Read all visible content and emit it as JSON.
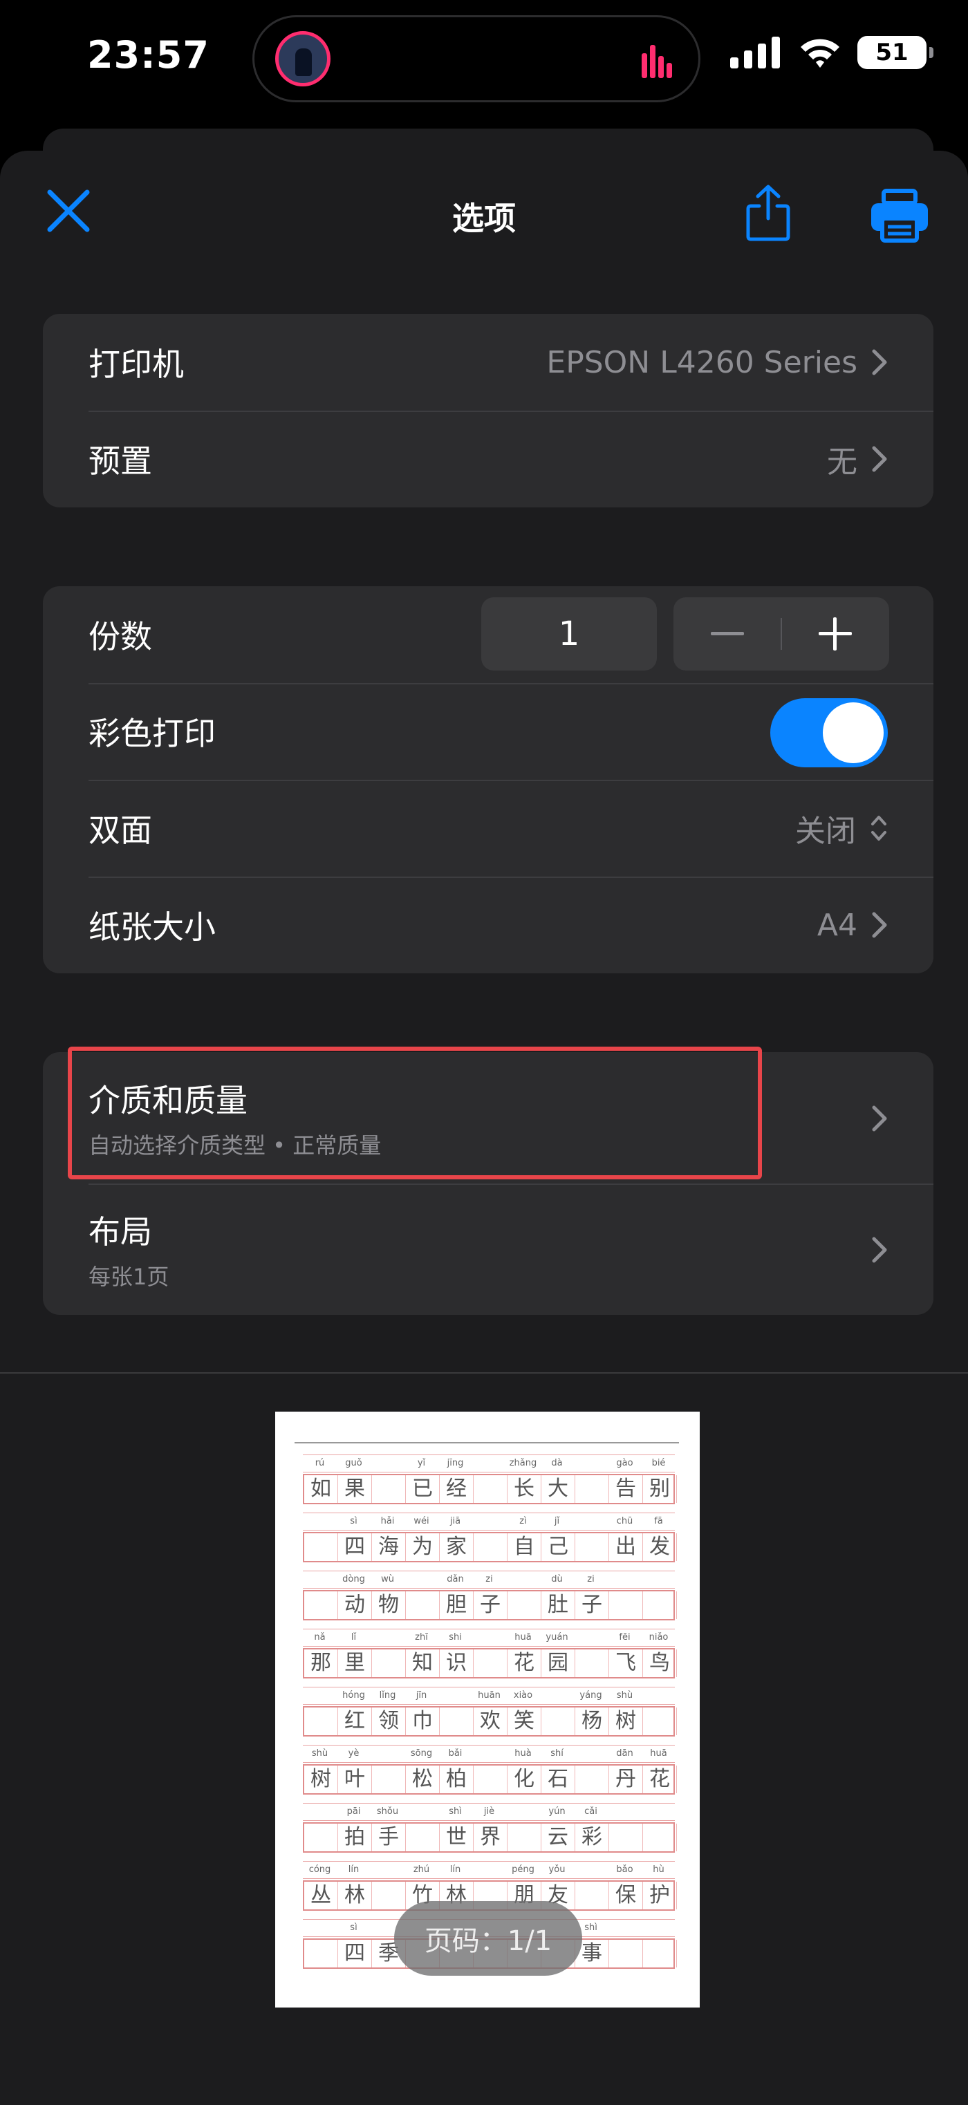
{
  "status_bar": {
    "time": "23:57",
    "battery": "51"
  },
  "nav": {
    "title": "选项"
  },
  "printer_group": {
    "rows": [
      {
        "label": "打印机",
        "value": "EPSON L4260 Series"
      },
      {
        "label": "预置",
        "value": "无"
      }
    ]
  },
  "settings_group": {
    "copies": {
      "label": "份数",
      "value": "1",
      "minus": "−",
      "plus": "+"
    },
    "color": {
      "label": "彩色打印",
      "on": true
    },
    "duplex": {
      "label": "双面",
      "value": "关闭"
    },
    "paper": {
      "label": "纸张大小",
      "value": "A4"
    }
  },
  "media_group": {
    "media": {
      "label": "介质和质量",
      "subtitle": "自动选择介质类型 • 正常质量"
    },
    "layout": {
      "label": "布局",
      "subtitle": "每张1页"
    }
  },
  "preview": {
    "page_indicator": "页码：1/1",
    "lines": [
      {
        "pinyin": [
          "rú",
          "guǒ",
          "",
          "yǐ",
          "jīng",
          "",
          "zhǎng",
          "dà",
          "",
          "gào",
          "bié"
        ],
        "chars": [
          "如",
          "果",
          "",
          "已",
          "经",
          "",
          "长",
          "大",
          "",
          "告",
          "别"
        ]
      },
      {
        "pinyin": [
          "",
          "sì",
          "hǎi",
          "wéi",
          "jiā",
          "",
          "zì",
          "jǐ",
          "",
          "chū",
          "fā"
        ],
        "chars": [
          "",
          "四",
          "海",
          "为",
          "家",
          "",
          "自",
          "己",
          "",
          "出",
          "发"
        ]
      },
      {
        "pinyin": [
          "",
          "dòng",
          "wù",
          "",
          "dǎn",
          "zi",
          "",
          "dù",
          "zi",
          "",
          ""
        ],
        "chars": [
          "",
          "动",
          "物",
          "",
          "胆",
          "子",
          "",
          "肚",
          "子",
          "",
          ""
        ]
      },
      {
        "pinyin": [
          "nǎ",
          "lǐ",
          "",
          "zhī",
          "shi",
          "",
          "huā",
          "yuán",
          "",
          "fēi",
          "niǎo"
        ],
        "chars": [
          "那",
          "里",
          "",
          "知",
          "识",
          "",
          "花",
          "园",
          "",
          "飞",
          "鸟"
        ]
      },
      {
        "pinyin": [
          "",
          "hóng",
          "lǐng",
          "jīn",
          "",
          "huān",
          "xiào",
          "",
          "yáng",
          "shù",
          ""
        ],
        "chars": [
          "",
          "红",
          "领",
          "巾",
          "",
          "欢",
          "笑",
          "",
          "杨",
          "树",
          ""
        ]
      },
      {
        "pinyin": [
          "shù",
          "yè",
          "",
          "sōng",
          "bǎi",
          "",
          "huà",
          "shí",
          "",
          "dān",
          "huā"
        ],
        "chars": [
          "树",
          "叶",
          "",
          "松",
          "柏",
          "",
          "化",
          "石",
          "",
          "丹",
          "花"
        ]
      },
      {
        "pinyin": [
          "",
          "pāi",
          "shǒu",
          "",
          "shì",
          "jiè",
          "",
          "yún",
          "cǎi",
          "",
          ""
        ],
        "chars": [
          "",
          "拍",
          "手",
          "",
          "世",
          "界",
          "",
          "云",
          "彩",
          "",
          ""
        ]
      },
      {
        "pinyin": [
          "cóng",
          "lín",
          "",
          "zhú",
          "lín",
          "",
          "péng",
          "yǒu",
          "",
          "bǎo",
          "hù"
        ],
        "chars": [
          "丛",
          "林",
          "",
          "竹",
          "林",
          "",
          "朋",
          "友",
          "",
          "保",
          "护"
        ]
      },
      {
        "pinyin": [
          "",
          "sì",
          "",
          "",
          "",
          "",
          "",
          "",
          "shì",
          "",
          ""
        ],
        "chars": [
          "",
          "四",
          "季",
          "",
          "",
          "",
          "",
          "",
          "事",
          "",
          ""
        ]
      }
    ]
  },
  "colors": {
    "accent": "#0a84ff",
    "highlight": "#e8454a",
    "group_bg": "#2c2c2e",
    "sheet_bg": "#1c1c1e"
  }
}
